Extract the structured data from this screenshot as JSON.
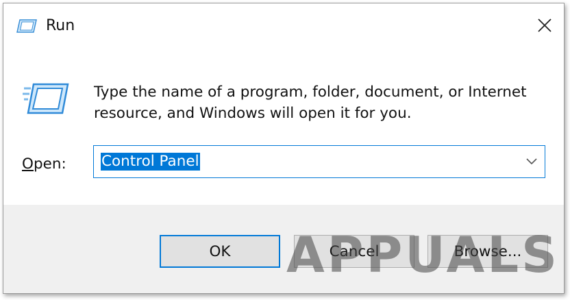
{
  "window": {
    "title": "Run",
    "close_glyph": "✕"
  },
  "content": {
    "description_line1": "Type the name of a program, folder, document, or Internet",
    "description_line2": "resource, and Windows will open it for you.",
    "open_label_prefix": "O",
    "open_label_rest": "pen:",
    "input_value": "Control Panel"
  },
  "buttons": {
    "ok": "OK",
    "cancel": "Cancel",
    "browse": "Browse..."
  },
  "watermark": "APPUALS",
  "colors": {
    "accent": "#0078d7",
    "footer_bg": "#f0f0f0",
    "button_bg": "#e1e1e1"
  },
  "icons": {
    "title": "run-icon",
    "big": "run-icon",
    "close": "close-icon",
    "dropdown": "chevron-down-icon"
  }
}
